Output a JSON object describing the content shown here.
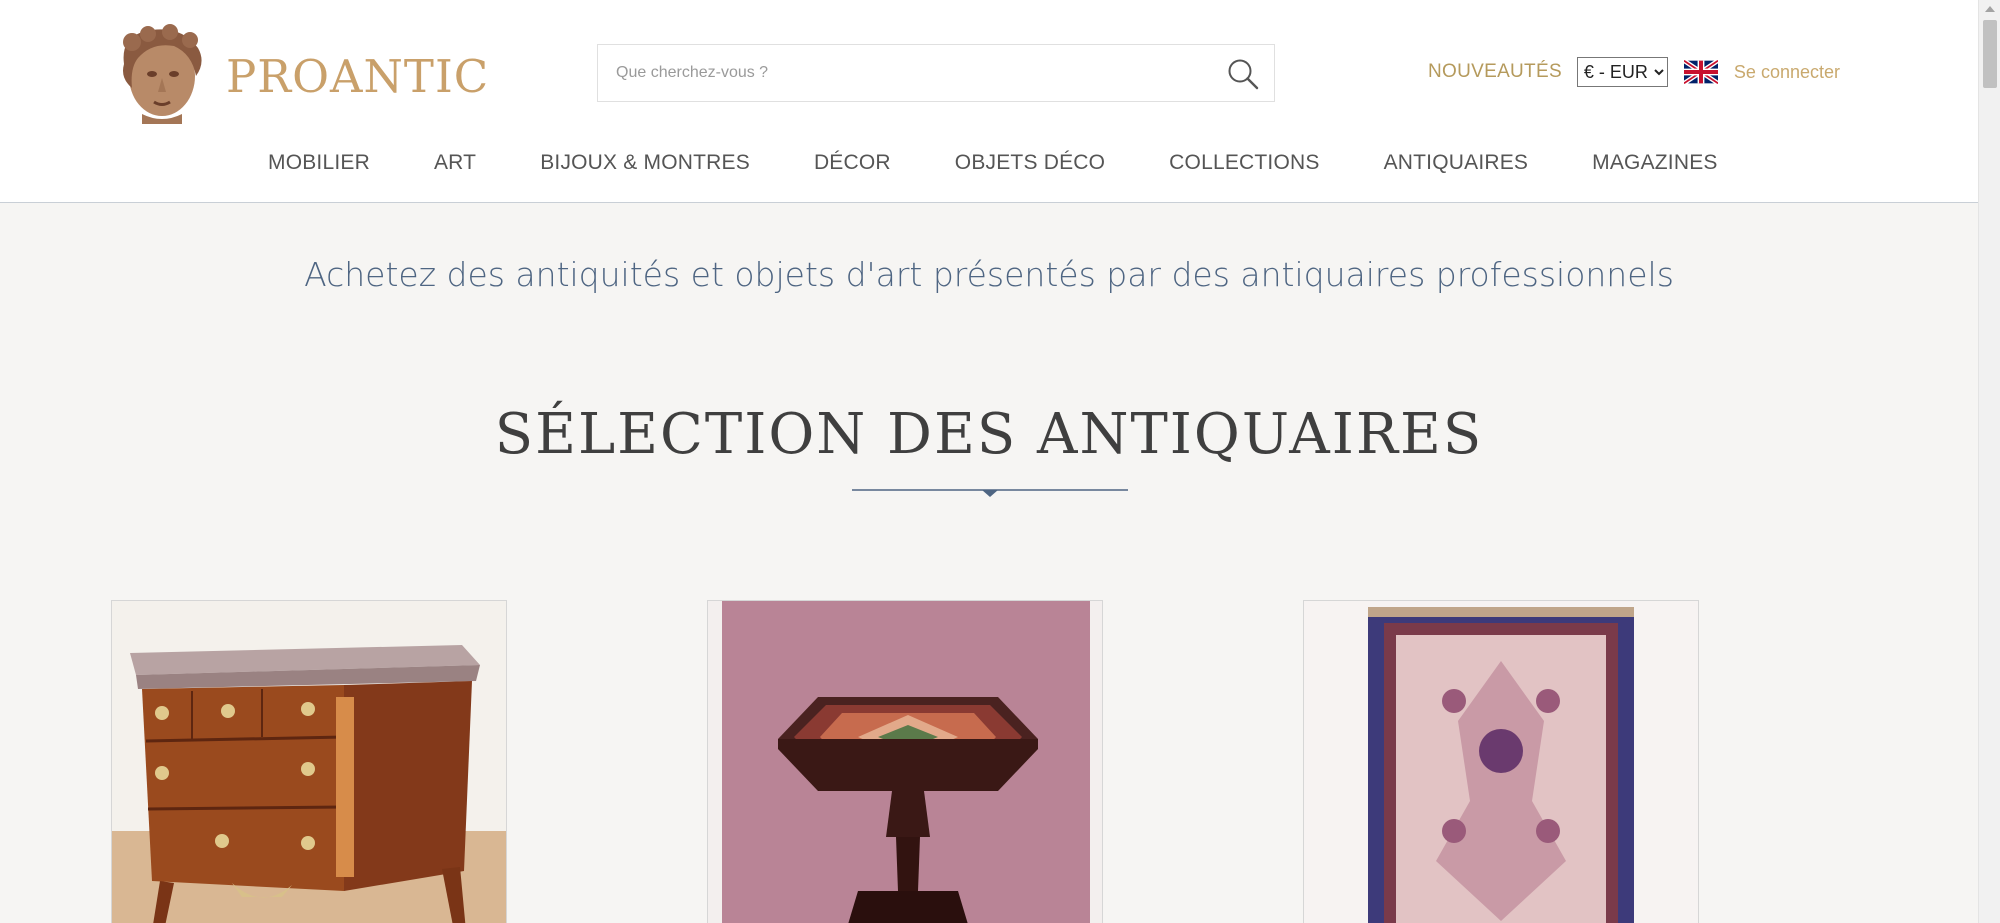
{
  "logo": {
    "text": "PROANTIC"
  },
  "search": {
    "placeholder": "Que cherchez-vous ?"
  },
  "header_tools": {
    "nouveautes": "NOUVEAUTÉS",
    "currency_selected": "€ - EUR",
    "login": "Se connecter",
    "flag_icon": "uk-flag-icon"
  },
  "nav": {
    "items": [
      {
        "label": "MOBILIER"
      },
      {
        "label": "ART"
      },
      {
        "label": "BIJOUX & MONTRES"
      },
      {
        "label": "DÉCOR"
      },
      {
        "label": "OBJETS DÉCO"
      },
      {
        "label": "COLLECTIONS"
      },
      {
        "label": "ANTIQUAIRES"
      },
      {
        "label": "MAGAZINES"
      }
    ]
  },
  "tagline": "Achetez des antiquités et objets d'art présentés par des antiquaires professionnels",
  "section": {
    "title": "SÉLECTION DES ANTIQUAIRES"
  },
  "cards": [
    {
      "image": "commode-image"
    },
    {
      "image": "pietra-dura-table-image"
    },
    {
      "image": "persian-rug-image"
    }
  ],
  "colors": {
    "gold": "#b59a5c",
    "login_gold": "#c9a96e",
    "tagline_blue": "#4e6582",
    "title_gray": "#3f3f3f",
    "background": "#f6f5f3"
  }
}
